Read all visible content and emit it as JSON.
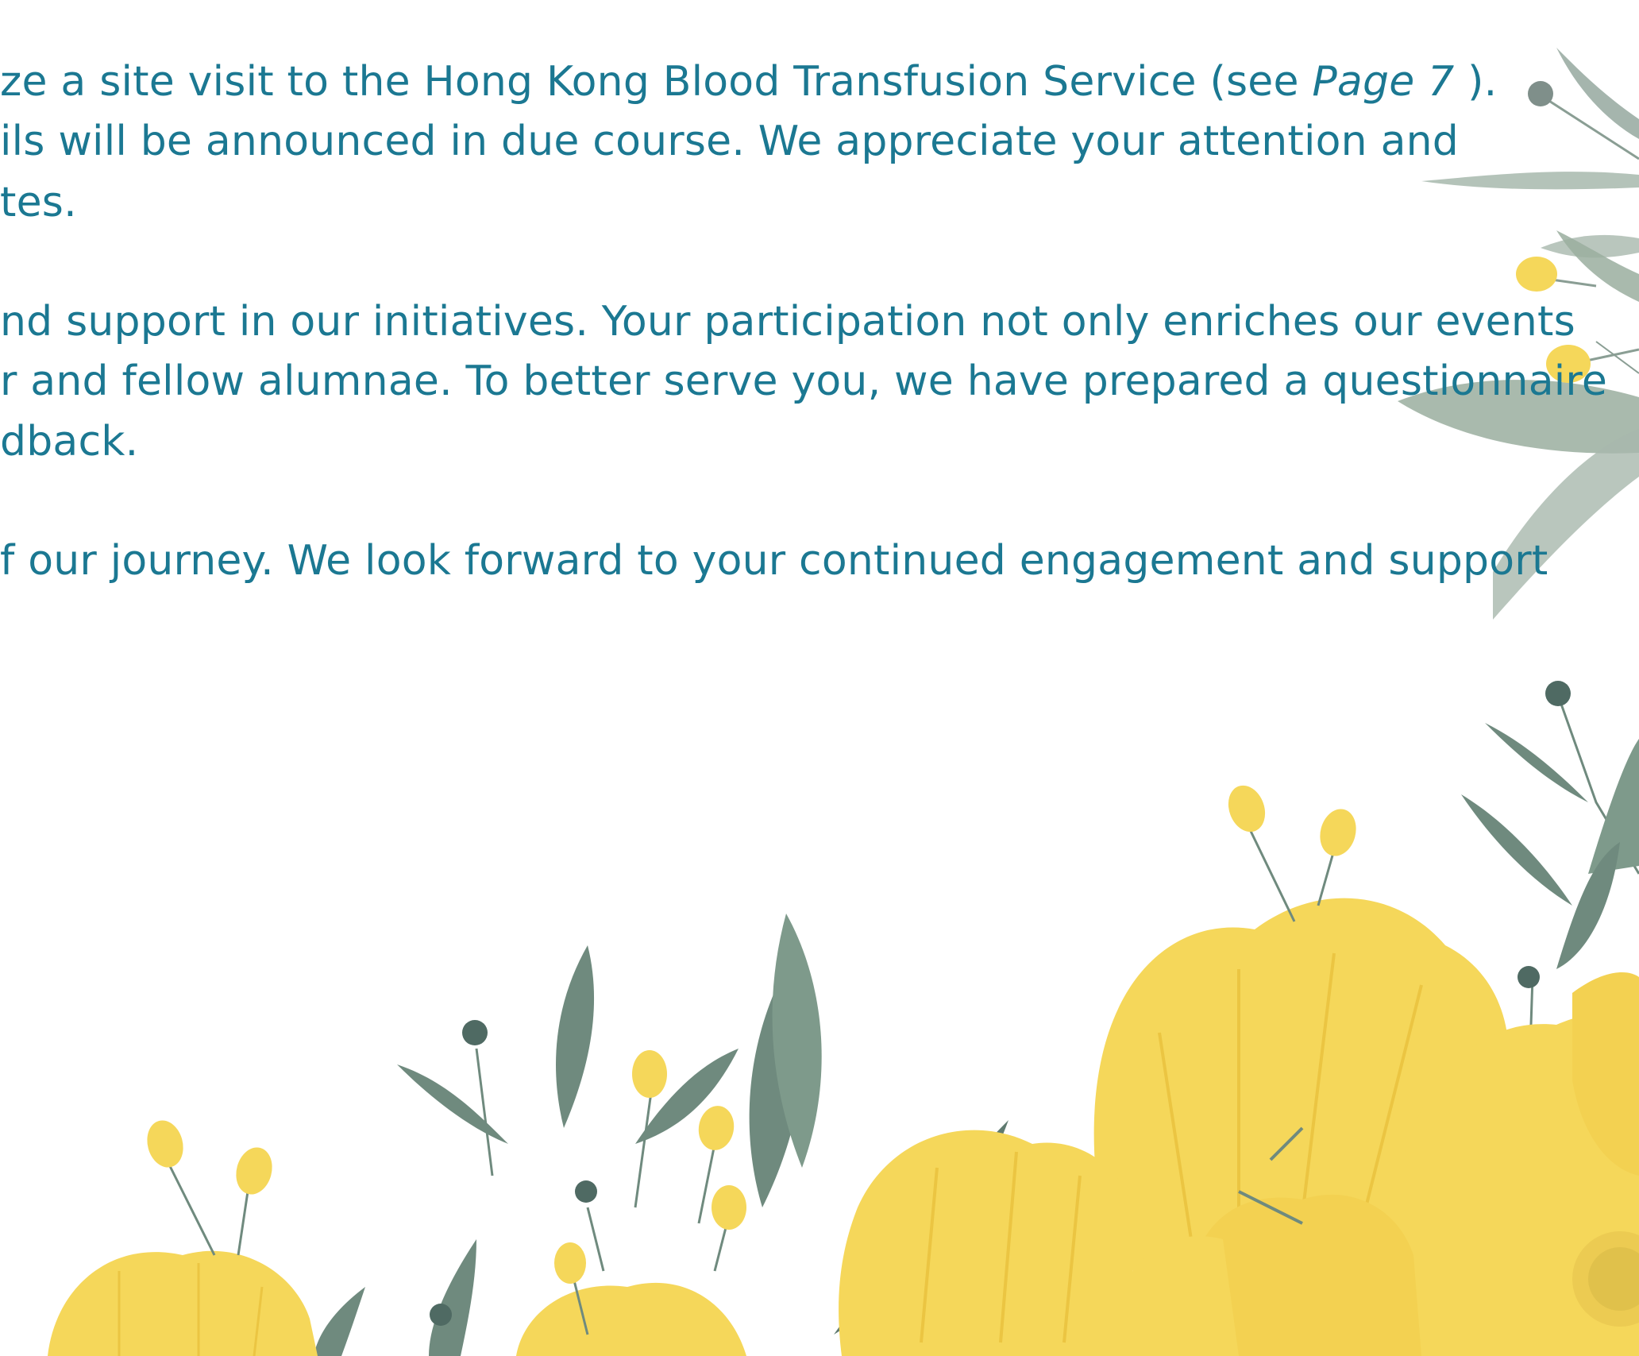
{
  "paragraphs": [
    {
      "lines": [
        {
          "pre": "ze a site visit to the Hong Kong Blood Transfusion Service (see ",
          "em": "Page 7",
          "post": " )."
        },
        {
          "text": "ils will be announced in due course. We appreciate your attention and"
        },
        {
          "text": "tes."
        }
      ]
    },
    {
      "lines": [
        {
          "text": "nd support in our initiatives. Your participation not only enriches our events"
        },
        {
          "text": "r and fellow alumnae. To better serve you, we have prepared a questionnaire"
        },
        {
          "text": "dback."
        }
      ]
    },
    {
      "lines": [
        {
          "text": "f our journey. We look forward to your continued engagement and support"
        }
      ]
    }
  ],
  "decoration": {
    "flower_color": "#f5d75a",
    "flower_shade": "#e9c13c",
    "leaf_color": "#6f8a7e",
    "leaf_light": "#a7b8ad",
    "bud_dark": "#4f6a63"
  }
}
